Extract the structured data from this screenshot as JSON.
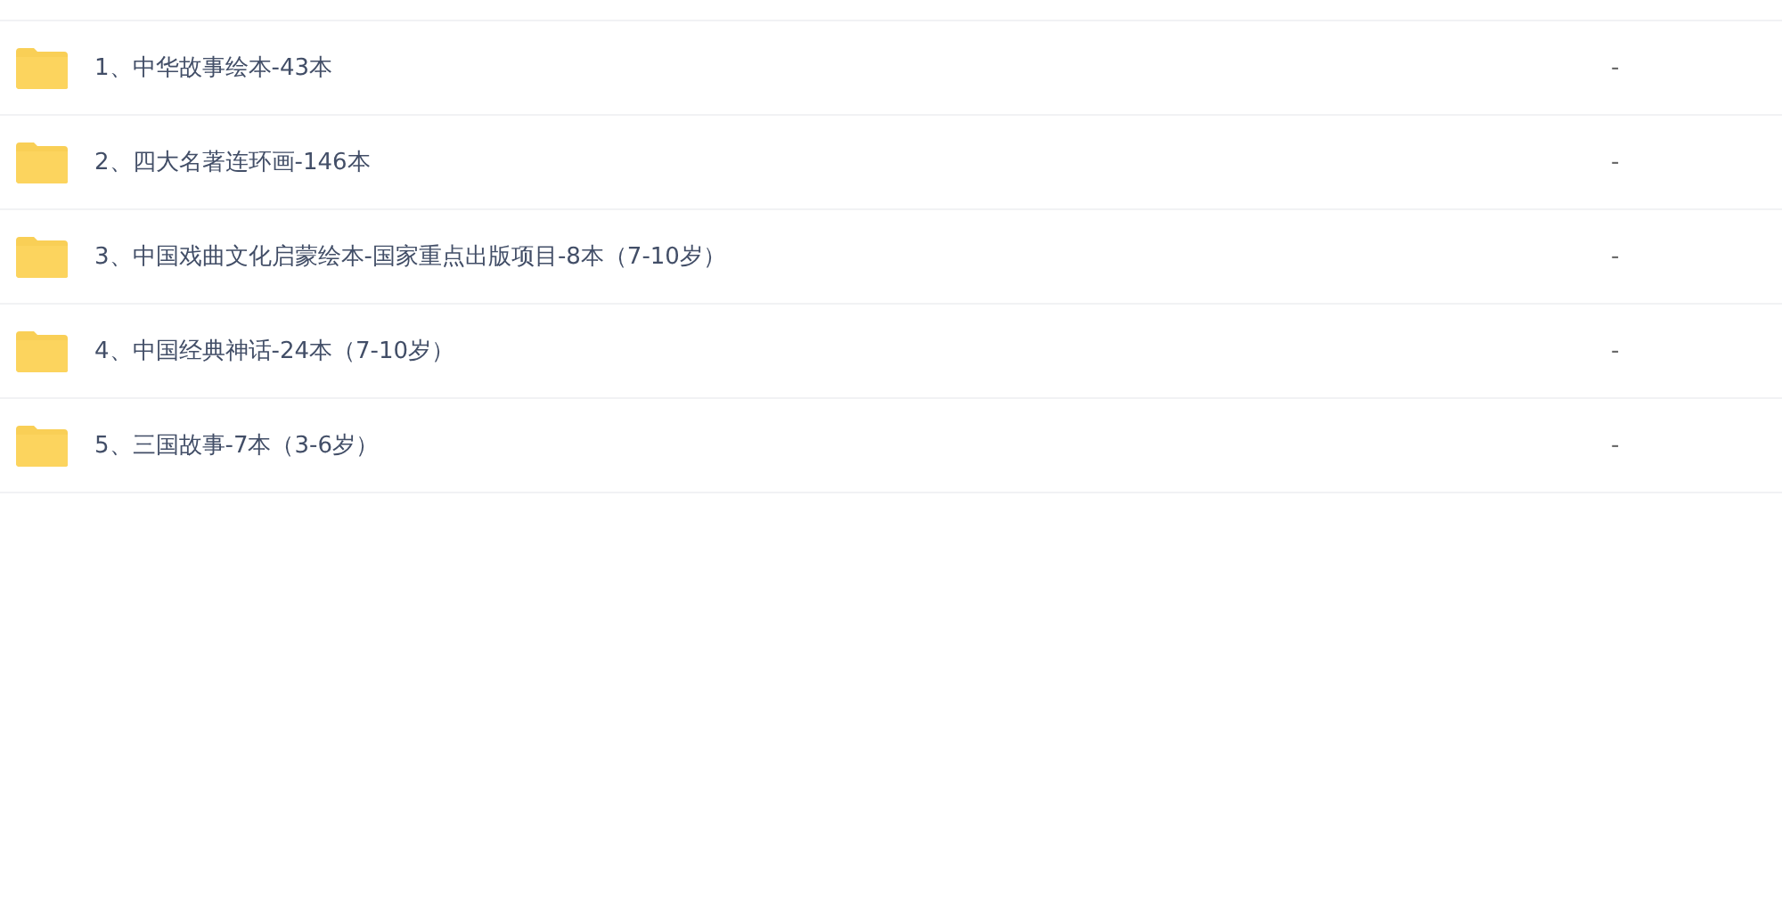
{
  "files": [
    {
      "name": "1、中华故事绘本-43本",
      "size": "-"
    },
    {
      "name": "2、四大名著连环画-146本",
      "size": "-"
    },
    {
      "name": "3、中国戏曲文化启蒙绘本-国家重点出版项目-8本（7-10岁）",
      "size": "-"
    },
    {
      "name": "4、中国经典神话-24本（7-10岁）",
      "size": "-"
    },
    {
      "name": "5、三国故事-7本（3-6岁）",
      "size": "-"
    }
  ]
}
